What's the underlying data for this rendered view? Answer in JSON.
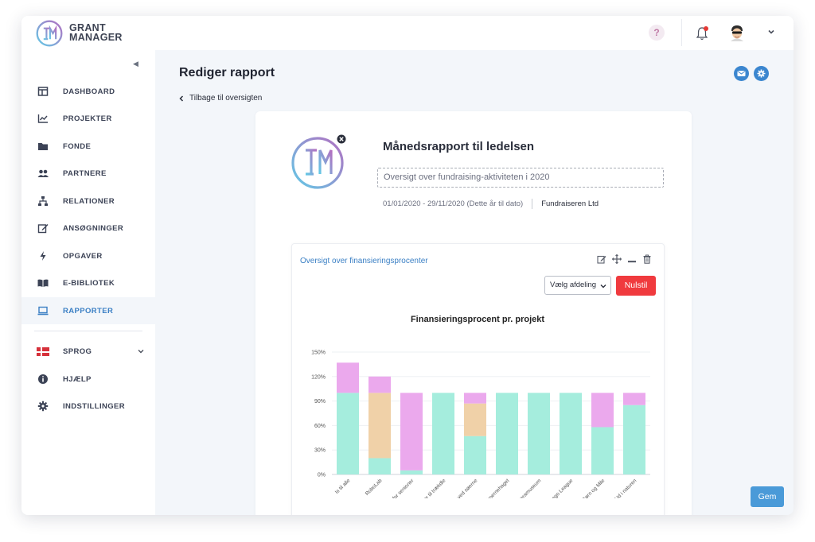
{
  "brand": {
    "line1": "GRANT",
    "line2": "MANAGER"
  },
  "header": {
    "help_label": "?"
  },
  "sidebar": {
    "items": [
      {
        "label": "DASHBOARD",
        "icon": "dashboard-icon"
      },
      {
        "label": "PROJEKTER",
        "icon": "chart-line-icon"
      },
      {
        "label": "FONDE",
        "icon": "folder-icon"
      },
      {
        "label": "PARTNERE",
        "icon": "users-icon"
      },
      {
        "label": "RELATIONER",
        "icon": "sitemap-icon"
      },
      {
        "label": "ANSØGNINGER",
        "icon": "edit-icon"
      },
      {
        "label": "OPGAVER",
        "icon": "bolt-icon"
      },
      {
        "label": "E-BIBLIOTEK",
        "icon": "book-icon"
      },
      {
        "label": "RAPPORTER",
        "icon": "laptop-icon",
        "active": true
      }
    ],
    "bottom_items": [
      {
        "label": "SPROG",
        "icon": "danish-flag-icon"
      },
      {
        "label": "HJÆLP",
        "icon": "info-icon"
      },
      {
        "label": "INDSTILLINGER",
        "icon": "gear-icon"
      }
    ]
  },
  "page": {
    "title": "Rediger rapport",
    "back_label": "Tilbage til oversigten"
  },
  "report": {
    "title": "Månedsrapport til ledelsen",
    "subtitle": "Oversigt over fundraising-aktiviteten i 2020",
    "date_range": "01/01/2020 - 29/11/2020 (Dette år til dato)",
    "organization": "Fundraiseren Ltd"
  },
  "widget": {
    "title": "Oversigt over finansieringsprocenter",
    "select_value": "Vælg afdeling",
    "reset_label": "Nulstil"
  },
  "save_label": "Gem",
  "colors": {
    "accent": "#3a7fc4",
    "danger": "#f03a3e",
    "teal": "#a5eddd",
    "peach": "#f0d1a8",
    "pink": "#eba9ed"
  },
  "chart_data": {
    "type": "bar",
    "stacked": true,
    "title": "Finansieringsprocent pr. projekt",
    "categories": [
      "Is til alle",
      "RoboLab",
      "al for senioner",
      "nter til trækdle",
      "er ved søerne",
      "i boernehaget",
      "teramuseum",
      "Lego League",
      "Børn og Mile",
      "Ud i naturen"
    ],
    "series": [
      {
        "color": "#a5eddd",
        "values": [
          100,
          20,
          5,
          100,
          47,
          100,
          100,
          100,
          58,
          85
        ]
      },
      {
        "color": "#f0d1a8",
        "values": [
          0,
          80,
          0,
          0,
          40,
          0,
          0,
          0,
          0,
          0
        ]
      },
      {
        "color": "#eba9ed",
        "values": [
          37,
          20,
          95,
          0,
          13,
          0,
          0,
          0,
          42,
          15
        ]
      }
    ],
    "y_ticks": [
      "0%",
      "30%",
      "60%",
      "90%",
      "120%",
      "150%"
    ],
    "ylim": [
      0,
      150
    ],
    "grid": true
  }
}
